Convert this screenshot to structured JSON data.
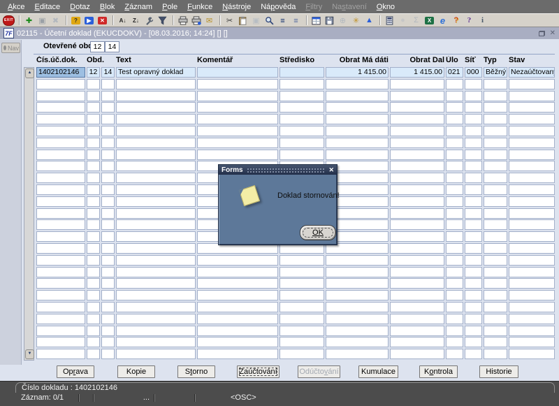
{
  "window": {
    "title": "02115 - Účetní doklad (EKUCDOKV) - [08.03.2016; 14:24] [] []",
    "app_icon": "7F"
  },
  "menu": {
    "items": [
      {
        "pre": "",
        "u": "A",
        "post": "kce",
        "disabled": false
      },
      {
        "pre": "",
        "u": "E",
        "post": "ditace",
        "disabled": false
      },
      {
        "pre": "",
        "u": "D",
        "post": "otaz",
        "disabled": false
      },
      {
        "pre": "",
        "u": "B",
        "post": "lok",
        "disabled": false
      },
      {
        "pre": "",
        "u": "Z",
        "post": "áznam",
        "disabled": false
      },
      {
        "pre": "",
        "u": "P",
        "post": "ole",
        "disabled": false
      },
      {
        "pre": "",
        "u": "F",
        "post": "unkce",
        "disabled": false
      },
      {
        "pre": "",
        "u": "N",
        "post": "ástroje",
        "disabled": false
      },
      {
        "pre": "Ná",
        "u": "p",
        "post": "ověda",
        "disabled": false
      },
      {
        "pre": "",
        "u": "F",
        "post": "iltry",
        "disabled": true
      },
      {
        "pre": "Na",
        "u": "s",
        "post": "tavení",
        "disabled": true
      },
      {
        "pre": "",
        "u": "O",
        "post": "kno",
        "disabled": false
      }
    ]
  },
  "toolbar": {
    "icons": [
      {
        "name": "exit-icon",
        "kind": "exit",
        "text": "EXIT"
      },
      {
        "sep": true
      },
      {
        "name": "insert-record-icon",
        "kind": "glyph",
        "text": "✚",
        "fg": "#1a8a1a"
      },
      {
        "name": "update-record-icon",
        "kind": "glyph",
        "text": "▣",
        "fg": "#9aa0a6"
      },
      {
        "name": "delete-record-icon",
        "kind": "glyph",
        "text": "✖",
        "fg": "#b2b8be"
      },
      {
        "sep": true
      },
      {
        "name": "enter-query-icon",
        "kind": "box",
        "bg": "#dfa713",
        "text": "?",
        "fg": "#2a2a2a"
      },
      {
        "name": "execute-query-icon",
        "kind": "box",
        "bg": "#2b5fd9",
        "text": "▶",
        "fg": "#ffffff"
      },
      {
        "name": "cancel-query-icon",
        "kind": "box",
        "bg": "#cf2929",
        "text": "✕",
        "fg": "#ffffff"
      },
      {
        "sep": true
      },
      {
        "name": "sort-ascending-icon",
        "kind": "glyph2",
        "text": "A↓",
        "fg": "#222222"
      },
      {
        "name": "sort-descending-icon",
        "kind": "glyph2",
        "text": "Z↓",
        "fg": "#222222"
      },
      {
        "name": "wrench-icon",
        "kind": "svg",
        "svg": "wrench"
      },
      {
        "name": "filter-icon",
        "kind": "svg",
        "svg": "funnel"
      },
      {
        "sep": true
      },
      {
        "name": "print-icon",
        "kind": "svg",
        "svg": "printer"
      },
      {
        "name": "print-setup-icon",
        "kind": "svg",
        "svg": "printer2"
      },
      {
        "name": "send-mail-icon",
        "kind": "glyph",
        "text": "✉",
        "fg": "#b8912a"
      },
      {
        "sep": true
      },
      {
        "name": "cut-icon",
        "kind": "glyph",
        "text": "✂",
        "fg": "#3a3a3a"
      },
      {
        "name": "paste-icon",
        "kind": "svg",
        "svg": "clipboard"
      },
      {
        "name": "copy-icon",
        "kind": "glyph",
        "text": "▣",
        "fg": "#b8bec4"
      },
      {
        "name": "find-icon",
        "kind": "svg",
        "svg": "magnifier"
      },
      {
        "name": "list-icon",
        "kind": "glyph2",
        "text": "≣",
        "fg": "#33497b"
      },
      {
        "name": "hierarchy-icon",
        "kind": "glyph2",
        "text": "≣",
        "fg": "#6a7da6"
      },
      {
        "sep": true
      },
      {
        "name": "form-icon",
        "kind": "svg",
        "svg": "calendar"
      },
      {
        "name": "save-icon",
        "kind": "svg",
        "svg": "floppy"
      },
      {
        "name": "globe-icon",
        "kind": "glyph",
        "text": "⊕",
        "fg": "#b2b8be"
      },
      {
        "name": "web-icon",
        "kind": "glyph",
        "text": "✳",
        "fg": "#c09020"
      },
      {
        "name": "mountain-icon",
        "kind": "glyph",
        "text": "▲",
        "fg": "#2b5fd9"
      },
      {
        "sep": true
      },
      {
        "name": "calculator-icon",
        "kind": "svg",
        "svg": "calc"
      },
      {
        "name": "clock-icon",
        "kind": "glyph",
        "text": "●",
        "fg": "#c6c6c6"
      },
      {
        "name": "sum-icon",
        "kind": "glyph",
        "text": "Σ",
        "fg": "#b2b8be"
      },
      {
        "name": "excel-icon",
        "kind": "box",
        "bg": "#1e7145",
        "text": "X",
        "fg": "#ffffff"
      },
      {
        "name": "browser-icon",
        "kind": "glyph",
        "text": "e",
        "fg": "#2b6fd9",
        "cls": "it"
      },
      {
        "name": "currency-help-icon",
        "kind": "glyph",
        "text": "?",
        "fg": "#cc2200",
        "cls": "gold-shadow"
      },
      {
        "name": "help-icon",
        "kind": "glyph",
        "text": "?",
        "fg": "#5b2d91",
        "cls": "serif"
      },
      {
        "name": "info-icon",
        "kind": "glyph",
        "text": "i",
        "fg": "#4a5a6a",
        "cls": "serif"
      }
    ]
  },
  "nav": {
    "label": "Nav"
  },
  "period": {
    "label": "Otevřené období",
    "values": [
      "12",
      "14"
    ]
  },
  "table": {
    "columns": [
      {
        "label": "Čís.úč.dok."
      },
      {
        "label": "Obd."
      },
      {
        "label": "Text"
      },
      {
        "label": "Komentář"
      },
      {
        "label": "Středisko"
      },
      {
        "label": "Obrat Má dáti"
      },
      {
        "label": "Obrat Dal"
      },
      {
        "label": "Úlo"
      },
      {
        "label": "Síť"
      },
      {
        "label": "Typ"
      },
      {
        "label": "Stav"
      }
    ],
    "rows": [
      {
        "cislo": "1402102146",
        "obd1": "12",
        "obd2": "14",
        "text": "Test opravný doklad",
        "komentar": "",
        "stredisko": "",
        "obrat_ma_dati": "1 415.00",
        "obrat_dal": "1 415.00",
        "ulo": "021",
        "sit": "000",
        "typ": "Běžný",
        "stav": "Nezaúčtovaný",
        "selected": true
      }
    ],
    "empty_row_count": 24
  },
  "dialog": {
    "title": "Forms",
    "message": "Doklad stornován!",
    "ok_label": "OK",
    "close_icon": "✕"
  },
  "actions": {
    "buttons": [
      {
        "pre": "Op",
        "u": "r",
        "post": "ava",
        "disabled": false,
        "focused": false
      },
      {
        "pre": "Kopie",
        "u": "",
        "post": "",
        "disabled": false,
        "focused": false
      },
      {
        "pre": "S",
        "u": "t",
        "post": "orno",
        "disabled": false,
        "focused": false
      },
      {
        "pre": "Zaúčtování",
        "u": "",
        "post": "",
        "disabled": false,
        "focused": true
      },
      {
        "pre": "Odúčto",
        "u": "v",
        "post": "ání",
        "disabled": true,
        "focused": false
      },
      {
        "pre": "Kumulace",
        "u": "",
        "post": "",
        "disabled": false,
        "focused": false
      },
      {
        "pre": "K",
        "u": "o",
        "post": "ntrola",
        "disabled": false,
        "focused": false
      },
      {
        "pre": "Historie",
        "u": "",
        "post": "",
        "disabled": false,
        "focused": false
      }
    ]
  },
  "status": {
    "message": "Číslo dokladu : 1402102146",
    "record": "Záznam: 0/1",
    "ellipsis": "...",
    "osc": "<OSC>"
  }
}
